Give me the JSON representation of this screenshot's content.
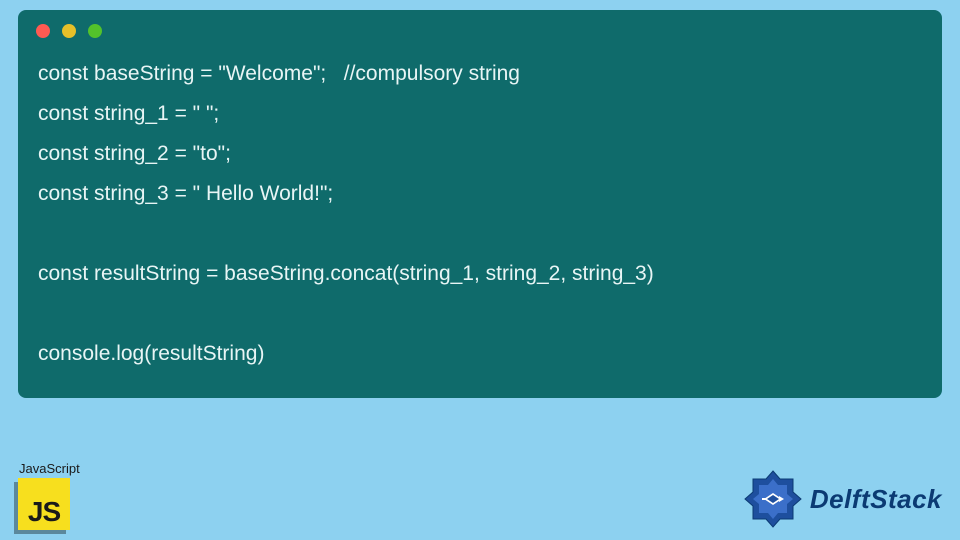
{
  "code": {
    "lines": [
      "const baseString = \"Welcome\";   //compulsory string",
      "const string_1 = \" \";",
      "const string_2 = \"to\";",
      "const string_3 = \" Hello World!\";",
      "",
      "const resultString = baseString.concat(string_1, string_2, string_3)",
      "",
      "console.log(resultString)"
    ]
  },
  "footer": {
    "language_label": "JavaScript",
    "language_short": "JS",
    "brand_name": "DelftStack"
  },
  "colors": {
    "page_bg": "#8dd1f0",
    "code_bg": "#0f6b6b",
    "code_text": "#e8f5f5",
    "js_yellow": "#f7df1e",
    "brand_blue": "#0b3a73"
  }
}
